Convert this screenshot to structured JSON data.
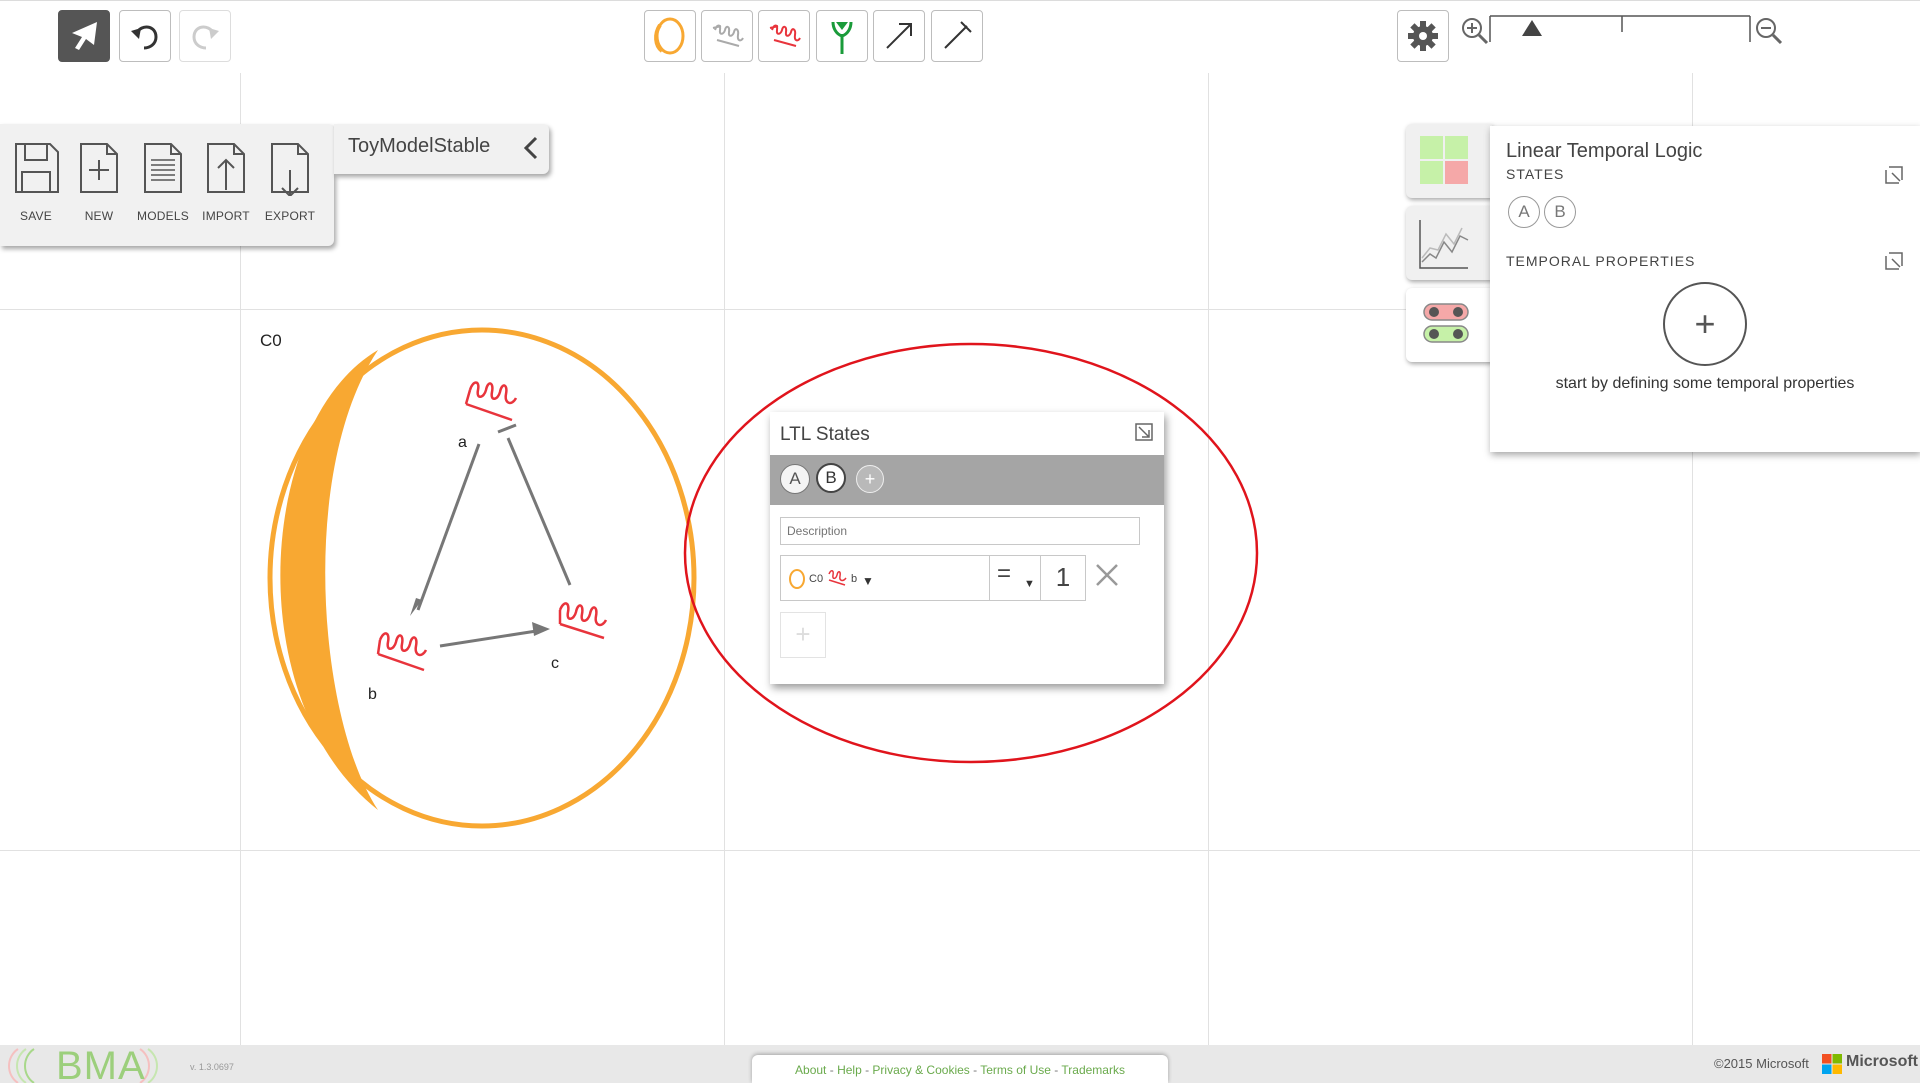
{
  "toolbar": {
    "left": [
      {
        "name": "pointer-tool",
        "icon": "arrow-pointer-icon",
        "state": "active"
      },
      {
        "name": "undo",
        "icon": "undo-icon",
        "state": "enabled"
      },
      {
        "name": "redo",
        "icon": "redo-icon",
        "state": "disabled"
      }
    ],
    "center": [
      {
        "name": "add-cell",
        "icon": "cell-icon"
      },
      {
        "name": "add-constant",
        "icon": "constant-icon"
      },
      {
        "name": "add-variable",
        "icon": "variable-icon"
      },
      {
        "name": "add-receptor",
        "icon": "receptor-icon"
      },
      {
        "name": "add-activator",
        "icon": "activator-arrow-icon"
      },
      {
        "name": "add-inhibitor",
        "icon": "inhibitor-arrow-icon"
      }
    ],
    "right": {
      "settings_icon": "gear-icon",
      "zoom_in_icon": "zoom-in-icon",
      "zoom_out_icon": "zoom-out-icon"
    }
  },
  "file_menu": {
    "model_name": "ToyModelStable",
    "items": [
      {
        "label": "SAVE",
        "icon": "save-icon"
      },
      {
        "label": "NEW",
        "icon": "new-file-icon"
      },
      {
        "label": "MODELS",
        "icon": "models-list-icon"
      },
      {
        "label": "IMPORT",
        "icon": "import-icon"
      },
      {
        "label": "EXPORT",
        "icon": "export-icon"
      }
    ]
  },
  "canvas": {
    "cell_label": "C0",
    "variables": [
      {
        "name": "a"
      },
      {
        "name": "b"
      },
      {
        "name": "c"
      }
    ],
    "colors": {
      "cell": "#f8a832",
      "variable": "#e8343c",
      "edge": "#777777",
      "highlight": "#e0141c"
    }
  },
  "ltl_states_popup": {
    "title": "LTL States",
    "states": [
      "A",
      "B"
    ],
    "selected_state": "B",
    "add_state": "+",
    "description_placeholder": "Description",
    "formula": {
      "cell": "C0",
      "variable": "b",
      "operator": "=",
      "value": "1"
    },
    "add_row": "+"
  },
  "ltl_panel": {
    "title": "Linear Temporal Logic",
    "states_heading": "STATES",
    "states": [
      "A",
      "B"
    ],
    "temporal_heading": "TEMPORAL PROPERTIES",
    "add_label": "+",
    "hint": "start by defining some temporal properties"
  },
  "footer": {
    "logo": "BMA",
    "version": "v. 1.3.0697",
    "links": [
      "About",
      "Help",
      "Privacy & Cookies",
      "Terms of Use",
      "Trademarks"
    ],
    "copyright": "©2015 Microsoft",
    "brand": "Microsoft"
  }
}
